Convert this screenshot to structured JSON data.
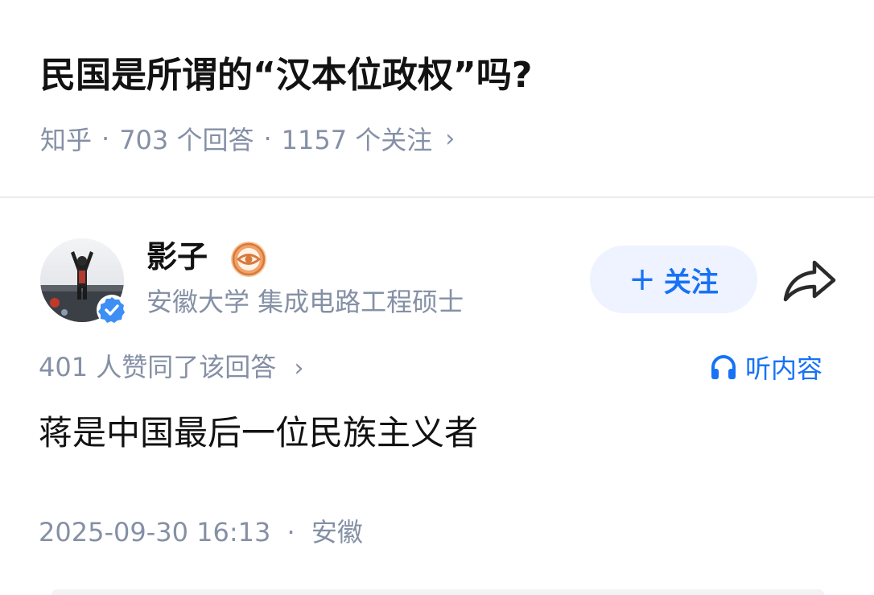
{
  "question": {
    "title": "民国是所谓的“汉本位政权”吗?",
    "source": "知乎",
    "answers_count": "703 个回答",
    "followers_count": "1157 个关注",
    "separator": "·",
    "chevron": "›"
  },
  "author": {
    "name": "影子",
    "description": "安徽大学 集成电路工程硕士",
    "follow_label": "关注",
    "follow_plus": "+"
  },
  "answer": {
    "vote_text": "401 人赞同了该回答",
    "listen_label": "听内容",
    "content": "蒋是中国最后一位民族主义者",
    "datetime": "2025-09-30 16:13",
    "location": "安徽"
  },
  "icons": {
    "medal": "medal-eye-icon",
    "verified": "verified-check-icon",
    "share": "share-arrow-icon",
    "listen": "headphones-icon"
  },
  "colors": {
    "accent": "#1772f6",
    "follow_bg": "#eef3ff",
    "secondary_text": "#8590a6",
    "primary_text": "#121212",
    "medal": "#e9883a"
  }
}
